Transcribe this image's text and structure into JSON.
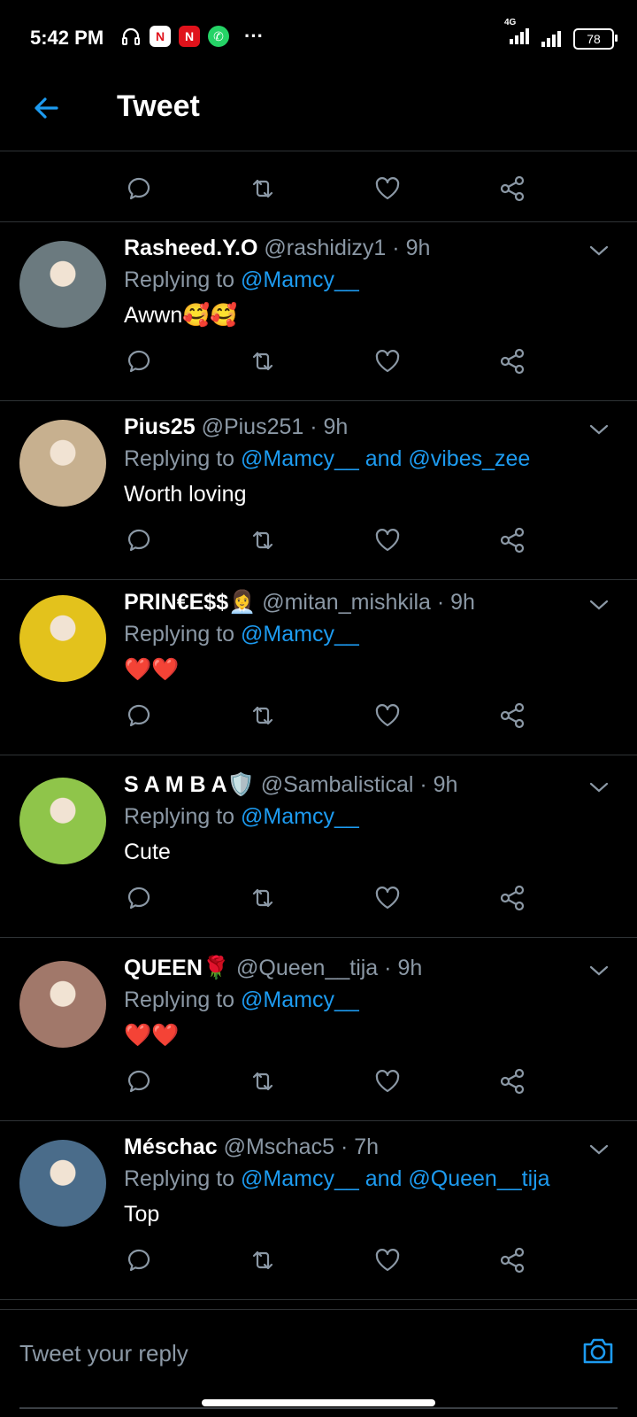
{
  "status_bar": {
    "time": "5:42 PM",
    "network_label": "4G",
    "battery": "78",
    "more": "···"
  },
  "header": {
    "title": "Tweet"
  },
  "replies": [
    {
      "name": "Rasheed.Y.O",
      "handle": "@rashidizy1",
      "time": "· 9h",
      "replying_prefix": "Replying to",
      "mentions": "@Mamcy__",
      "text": "Awwn🥰🥰",
      "avatar_color": "#6b7a7f"
    },
    {
      "name": "Pius25",
      "handle": "@Pius251",
      "time": "· 9h",
      "replying_prefix": "Replying to",
      "mentions": "@Mamcy__ and @vibes_zee",
      "text": "Worth loving",
      "avatar_color": "#c7b08f"
    },
    {
      "name": "PRIN€E$$👩‍💼",
      "handle": "@mitan_mishkila",
      "time": "· 9h",
      "replying_prefix": "Replying to",
      "mentions": "@Mamcy__",
      "text": "❤️❤️",
      "avatar_color": "#e3c21c"
    },
    {
      "name": "S A M B A🛡️",
      "handle": "@Sambalistical",
      "time": "· 9h",
      "replying_prefix": "Replying to",
      "mentions": "@Mamcy__",
      "text": "Cute",
      "avatar_color": "#8fc54a"
    },
    {
      "name": "QUEEN🌹",
      "handle": "@Queen__tija",
      "time": "· 9h",
      "replying_prefix": "Replying to",
      "mentions": "@Mamcy__",
      "text": "❤️❤️",
      "avatar_color": "#a1786a"
    },
    {
      "name": "Méschac",
      "handle": "@Mschac5",
      "time": "· 7h",
      "replying_prefix": "Replying to",
      "mentions": "@Mamcy__ and @Queen__tija",
      "text": "Top",
      "avatar_color": "#4a6c8a"
    }
  ],
  "composer": {
    "placeholder": "Tweet your reply"
  },
  "colors": {
    "accent": "#1d9bf0",
    "secondary_text": "#8b98a5",
    "divider": "#2f3336"
  }
}
